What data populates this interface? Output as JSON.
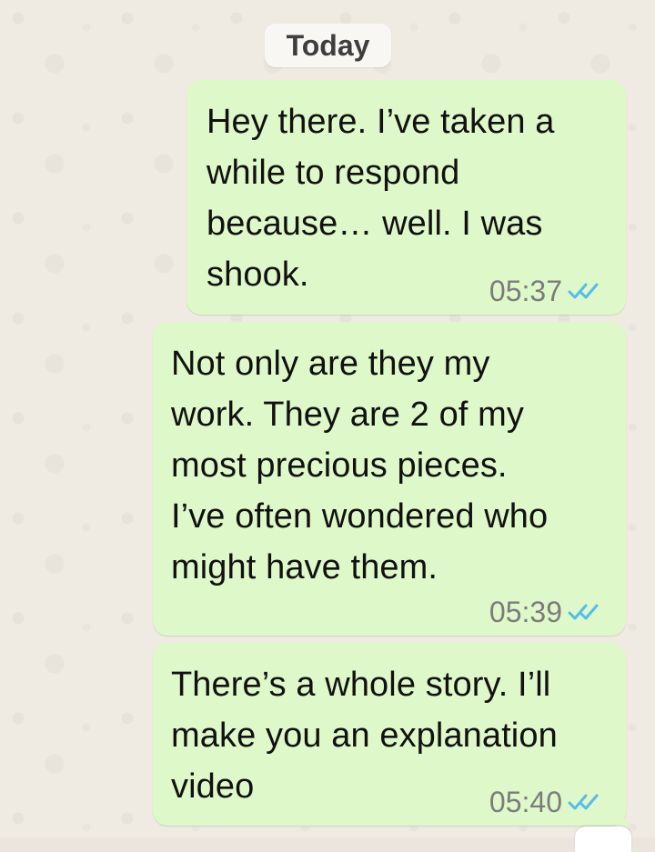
{
  "chat": {
    "date_chip": "Today",
    "messages": [
      {
        "text": "Hey there. I’ve taken a\nwhile to respond\nbecause… well. I was\nshook.",
        "time": "05:37",
        "status": "read"
      },
      {
        "text": "Not only are they my\nwork. They are 2 of my\nmost precious pieces.\nI’ve often wondered who\nmight have them.",
        "time": "05:39",
        "status": "read"
      },
      {
        "text": "There’s a whole story. I’ll\nmake you an explanation\nvideo",
        "time": "05:40",
        "status": "read"
      }
    ]
  },
  "colors": {
    "outgoing_bubble": "#dff8c9",
    "read_tick": "#53bdeb",
    "timestamp": "#7c7c7c",
    "wallpaper": "#efeae2"
  },
  "icons": {
    "read_status": "double-check-icon",
    "scroll_control": "scroll-down-button"
  }
}
